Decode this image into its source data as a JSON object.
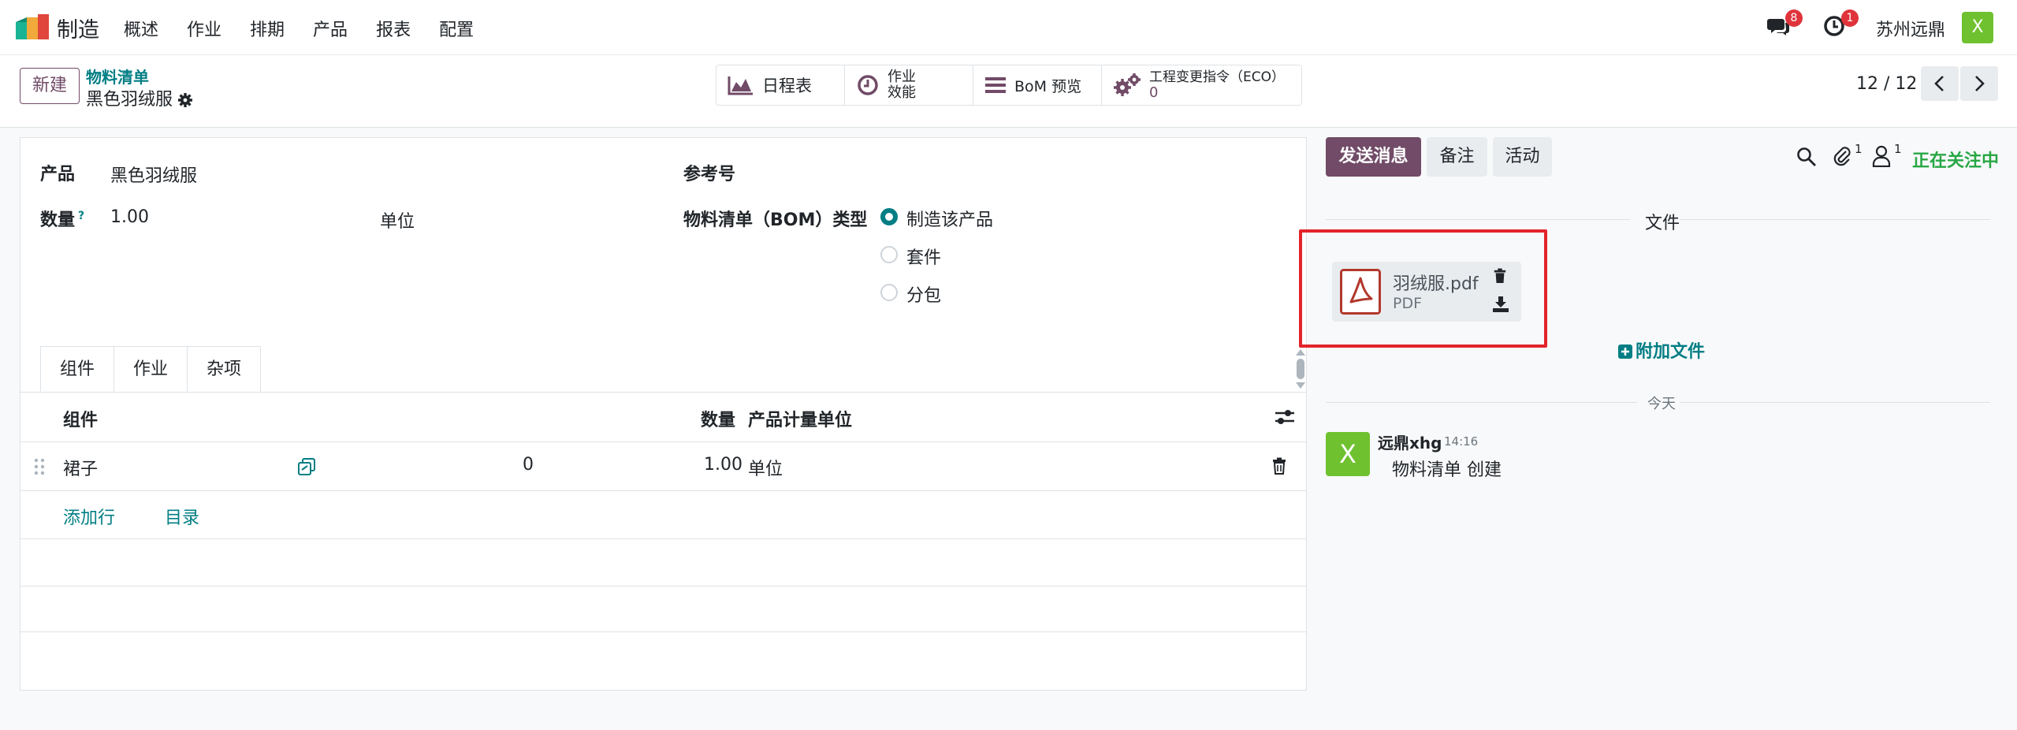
{
  "nav": {
    "app_name": "制造",
    "menu": [
      "概述",
      "作业",
      "排期",
      "产品",
      "报表",
      "配置"
    ],
    "messages_badge": "8",
    "activity_badge": "1",
    "company": "苏州远鼎",
    "avatar_letter": "X"
  },
  "control": {
    "new_button": "新建",
    "breadcrumb_parent": "物料清单",
    "record_title": "黑色羽绒服",
    "smart_buttons": {
      "schedule": "日程表",
      "efficiency_line1": "作业",
      "efficiency_line2": "效能",
      "bom_preview": "BoM 预览",
      "eco_label": "工程变更指令（ECO）",
      "eco_count": "0"
    },
    "pager": "12 / 12"
  },
  "form": {
    "product_label": "产品",
    "product_value": "黑色羽绒服",
    "quantity_label": "数量",
    "quantity_help": "?",
    "quantity_value": "1.00",
    "uom_value": "单位",
    "reference_label": "参考号",
    "bom_type_label": "物料清单（BOM）类型",
    "bom_type_options": [
      "制造该产品",
      "套件",
      "分包"
    ],
    "bom_type_selected": "制造该产品"
  },
  "tabs": [
    "组件",
    "作业",
    "杂项"
  ],
  "table": {
    "headers": {
      "component": "组件",
      "quantity": "数量",
      "uom": "产品计量单位"
    },
    "rows": [
      {
        "component": "裙子",
        "variant_col": "0",
        "quantity": "1.00",
        "uom": "单位"
      }
    ],
    "add_line": "添加行",
    "catalog": "目录"
  },
  "chatter": {
    "send_message": "发送消息",
    "log_note": "备注",
    "activity": "活动",
    "attachments_count": "1",
    "followers_count": "1",
    "following": "正在关注中",
    "files_title": "文件",
    "attachment": {
      "name": "羽绒服.pdf",
      "type": "PDF"
    },
    "add_files": "附加文件",
    "today": "今天",
    "message": {
      "author": "远鼎xhg",
      "time": "14:16",
      "body": "物料清单 创建",
      "avatar_letter": "X"
    }
  },
  "colors": {
    "brand": "#714b67",
    "accent": "#017e84",
    "success": "#28a745",
    "danger": "#e3242b"
  }
}
